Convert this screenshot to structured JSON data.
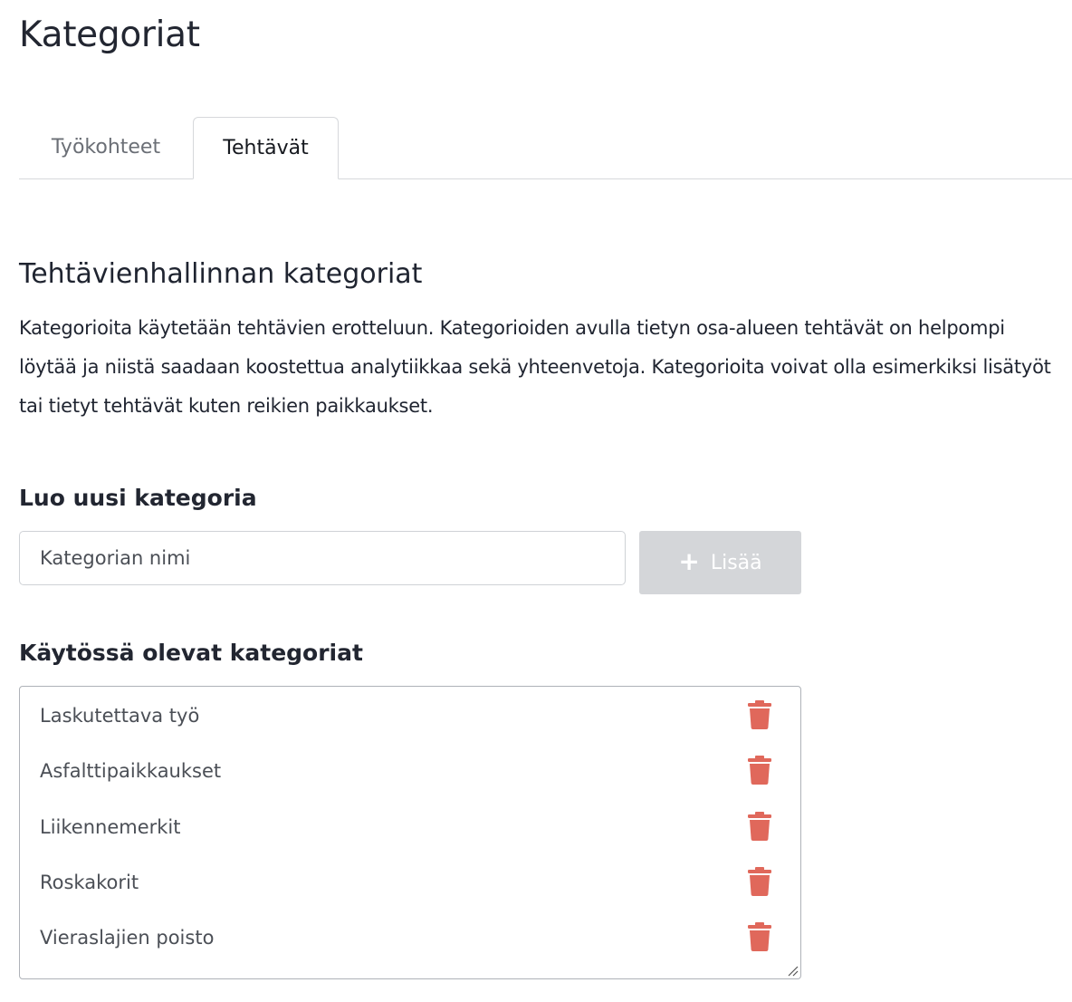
{
  "page": {
    "title": "Kategoriat"
  },
  "tabs": [
    {
      "label": "Työkohteet",
      "active": false
    },
    {
      "label": "Tehtävät",
      "active": true
    }
  ],
  "section": {
    "title": "Tehtävienhallinnan kategoriat",
    "description": "Kategorioita käytetään tehtävien erotteluun. Kategorioiden avulla tietyn osa-alueen tehtävät on helpompi löytää ja niistä saadaan koostettua analytiikkaa sekä yhteenvetoja. Kategorioita voivat olla esimerkiksi lisätyöt tai tietyt tehtävät kuten reikien paikkaukset."
  },
  "create": {
    "heading": "Luo uusi kategoria",
    "input_placeholder": "Kategorian nimi",
    "input_value": "",
    "add_button_label": "Lisää",
    "add_button_icon": "plus-icon",
    "add_button_disabled": true
  },
  "existing": {
    "heading": "Käytössä olevat kategoriat",
    "categories": [
      {
        "label": "Laskutettava työ",
        "delete_icon": "trash-icon"
      },
      {
        "label": "Asfalttipaikkaukset",
        "delete_icon": "trash-icon"
      },
      {
        "label": "Liikennemerkit",
        "delete_icon": "trash-icon"
      },
      {
        "label": "Roskakorit",
        "delete_icon": "trash-icon"
      },
      {
        "label": "Vieraslajien poisto",
        "delete_icon": "trash-icon"
      }
    ]
  },
  "colors": {
    "delete_icon": "#e0685b",
    "disabled_button": "#d4d6d9",
    "text": "#1f2430",
    "muted_text": "#4b4f56",
    "border": "#d6d8db"
  }
}
